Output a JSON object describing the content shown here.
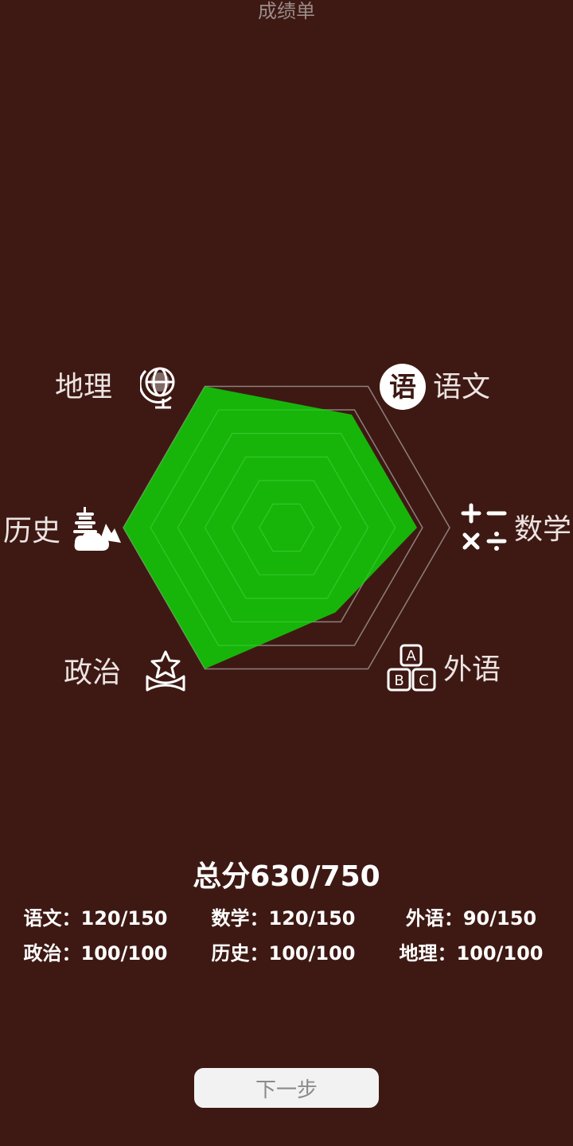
{
  "page": {
    "title": "成绩单",
    "colors": {
      "background": "#3e1913",
      "polygon_fill": "#17b50a",
      "grid_stroke": "#8f7f7c",
      "button_bg": "#f2f2f2"
    }
  },
  "chart_data": {
    "type": "radar",
    "axes": [
      "语文",
      "数学",
      "外语",
      "政治",
      "历史",
      "地理"
    ],
    "max": [
      150,
      150,
      150,
      100,
      100,
      100
    ],
    "values": [
      120,
      120,
      90,
      100,
      100,
      100
    ],
    "grid_levels": 6,
    "icons": [
      "chinese-char-icon",
      "math-operators-icon",
      "abc-blocks-icon",
      "star-book-icon",
      "pagoda-icon",
      "globe-icon"
    ]
  },
  "summary": {
    "total": "总分630/750"
  },
  "scores": [
    {
      "text": "语文：120/150"
    },
    {
      "text": "数学：120/150"
    },
    {
      "text": "外语：90/150"
    },
    {
      "text": "政治：100/100"
    },
    {
      "text": "历史：100/100"
    },
    {
      "text": "地理：100/100"
    }
  ],
  "actions": {
    "next_label": "下一步"
  }
}
